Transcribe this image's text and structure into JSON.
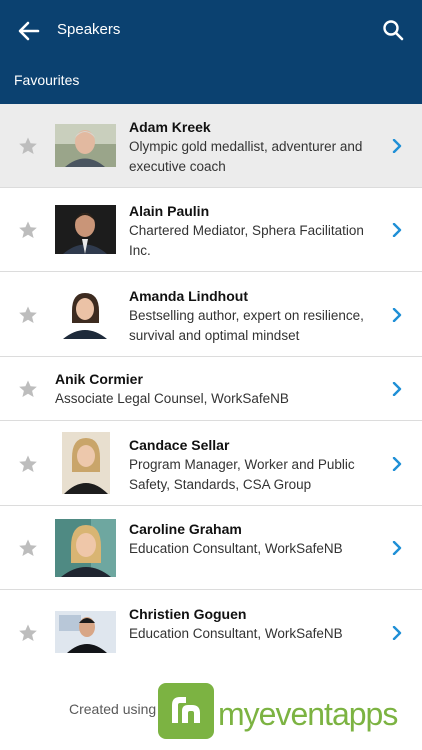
{
  "header": {
    "title": "Speakers",
    "section": "Favourites"
  },
  "speakers": [
    {
      "name": "Adam Kreek",
      "description": "Olympic gold medallist, adventurer and executive coach"
    },
    {
      "name": "Alain Paulin",
      "description": "Chartered Mediator, Sphera Facilitation Inc."
    },
    {
      "name": "Amanda Lindhout",
      "description": "Bestselling author, expert on resilience, survival and optimal mindset"
    },
    {
      "name": "Anik Cormier",
      "description": "Associate Legal Counsel, WorkSafeNB"
    },
    {
      "name": "Candace Sellar",
      "description": "Program Manager, Worker and Public Safety, Standards, CSA Group"
    },
    {
      "name": "Caroline Graham",
      "description": "Education Consultant, WorkSafeNB"
    },
    {
      "name": "Christien Goguen",
      "description": "Education Consultant, WorkSafeNB"
    }
  ],
  "footer": {
    "created_using": "Created using",
    "brand": "myeventapps"
  },
  "colors": {
    "header_bg": "#0b4170",
    "chevron": "#1f8fd6",
    "star": "#bdbdbd",
    "brand_green": "#7cb342"
  }
}
